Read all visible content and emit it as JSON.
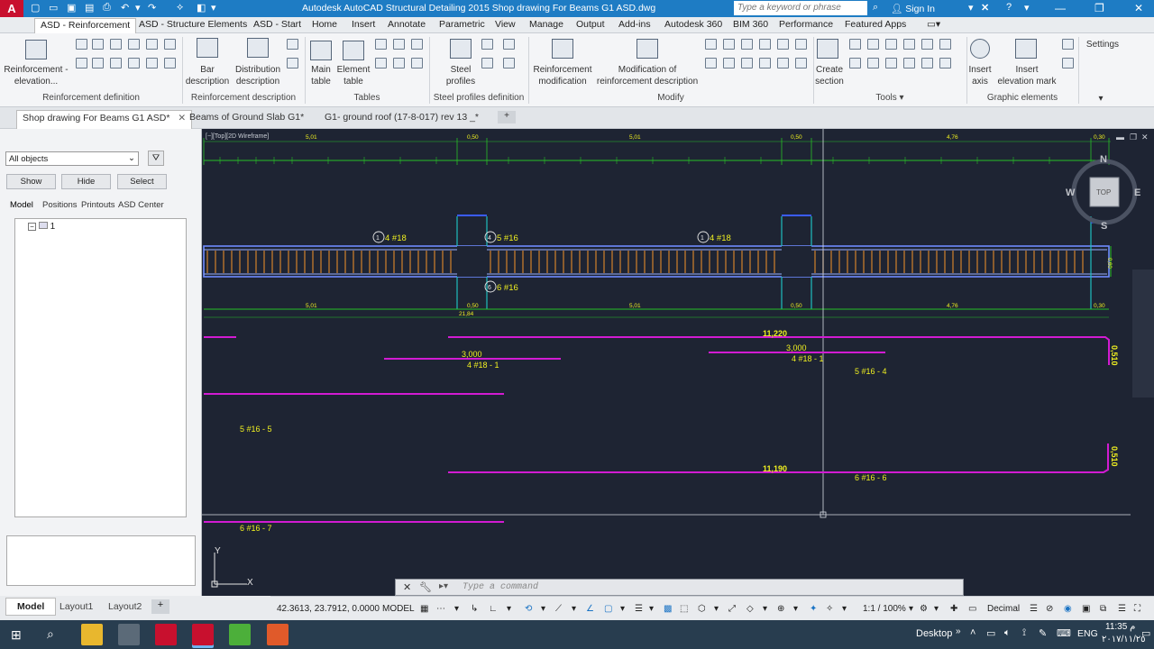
{
  "titlebar": {
    "app_icon": "A",
    "title": "Autodesk AutoCAD Structural Detailing 2015    Shop drawing For Beams G1 ASD.dwg",
    "search_placeholder": "Type a keyword or phrase",
    "sign_in": "Sign In"
  },
  "ribbon_tabs": [
    "ASD - Reinforcement",
    "ASD - Structure Elements",
    "ASD - Start",
    "Home",
    "Insert",
    "Annotate",
    "Parametric",
    "View",
    "Manage",
    "Output",
    "Add-ins",
    "Autodesk 360",
    "BIM 360",
    "Performance",
    "Featured Apps"
  ],
  "ribbon": {
    "reinf_elev": "Reinforcement -\nelevation...",
    "bar_desc": "Bar\ndescription",
    "dist_desc": "Distribution\ndescription",
    "main_table": "Main\ntable",
    "elem_table": "Element\ntable",
    "steel_profiles": "Steel\nprofiles",
    "reinf_mod": "Reinforcement\nmodification",
    "mod_reinf_desc": "Modification of\nreinforcement description",
    "create_section": "Create\nsection",
    "insert_axis": "Insert\naxis",
    "insert_elev_mark": "Insert\nelevation mark",
    "settings": "Settings",
    "groups": {
      "reinf_def": "Reinforcement definition",
      "reinf_desc": "Reinforcement description",
      "tables": "Tables",
      "steel_def": "Steel profiles definition",
      "modify": "Modify",
      "tools": "Tools",
      "graphic": "Graphic elements"
    }
  },
  "doc_tabs": [
    "Shop drawing For Beams G1 ASD*",
    "Beams of Ground Slab G1*",
    "G1- ground roof (17-8-017) rev 13 _*"
  ],
  "left_panel": {
    "filter": "All objects",
    "show": "Show",
    "hide": "Hide",
    "select": "Select",
    "tabs": [
      "Model",
      "Positions",
      "Printouts",
      "ASD Center"
    ],
    "tree_item": "1"
  },
  "viewport": {
    "label": "[−][Top][2D Wireframe]",
    "compass": {
      "n": "N",
      "s": "S",
      "e": "E",
      "w": "W",
      "top": "TOP"
    },
    "dims_top": [
      "5,01",
      "0,50",
      "5,01",
      "0,50",
      "4,76",
      "0,30"
    ],
    "dims_bottom": [
      "5,01",
      "0,50",
      "5,01",
      "0,50",
      "4,76",
      "0,30"
    ],
    "overall": "21,84",
    "height_dim": "0,60",
    "bar_labels": {
      "b1a": "4 #18",
      "b1a_num": "1",
      "b4": "5 #16",
      "b4_num": "4",
      "b1b": "4 #18",
      "b1b_num": "1",
      "b6": "6 #16",
      "b6_num": "6"
    },
    "schedule": {
      "l1": "11,220",
      "l2": "3,000",
      "l3": "4 #18 - 1",
      "l4": "3,000",
      "l5": "4 #18 - 1",
      "l6": "5 #16 - 4",
      "l7": "0,510",
      "l8": "5 #16 - 5",
      "l9": "11,190",
      "l10": "6 #16 - 6",
      "l11": "0,510",
      "l12": "6 #16 - 7"
    },
    "ucs_y": "Y",
    "ucs_x": "X"
  },
  "command": {
    "placeholder": "Type a command"
  },
  "model_tabs": [
    "Model",
    "Layout1",
    "Layout2"
  ],
  "status": {
    "coords": "42.3613, 23.7912, 0.0000",
    "model": "MODEL",
    "scale": "1:1 / 100%",
    "units": "Decimal"
  },
  "taskbar": {
    "desktop": "Desktop",
    "lang": "ENG",
    "time": "11:35 م",
    "date": "٢٠١٧/١١/٢٥"
  },
  "colors": {
    "title": "#1e7cc4",
    "canvas": "#1e2433",
    "magenta": "#d21bd2",
    "green": "#27c027",
    "yellow": "#f0f020",
    "rebar_orange": "#e38b2b",
    "beam_blue": "#6f8bff"
  }
}
